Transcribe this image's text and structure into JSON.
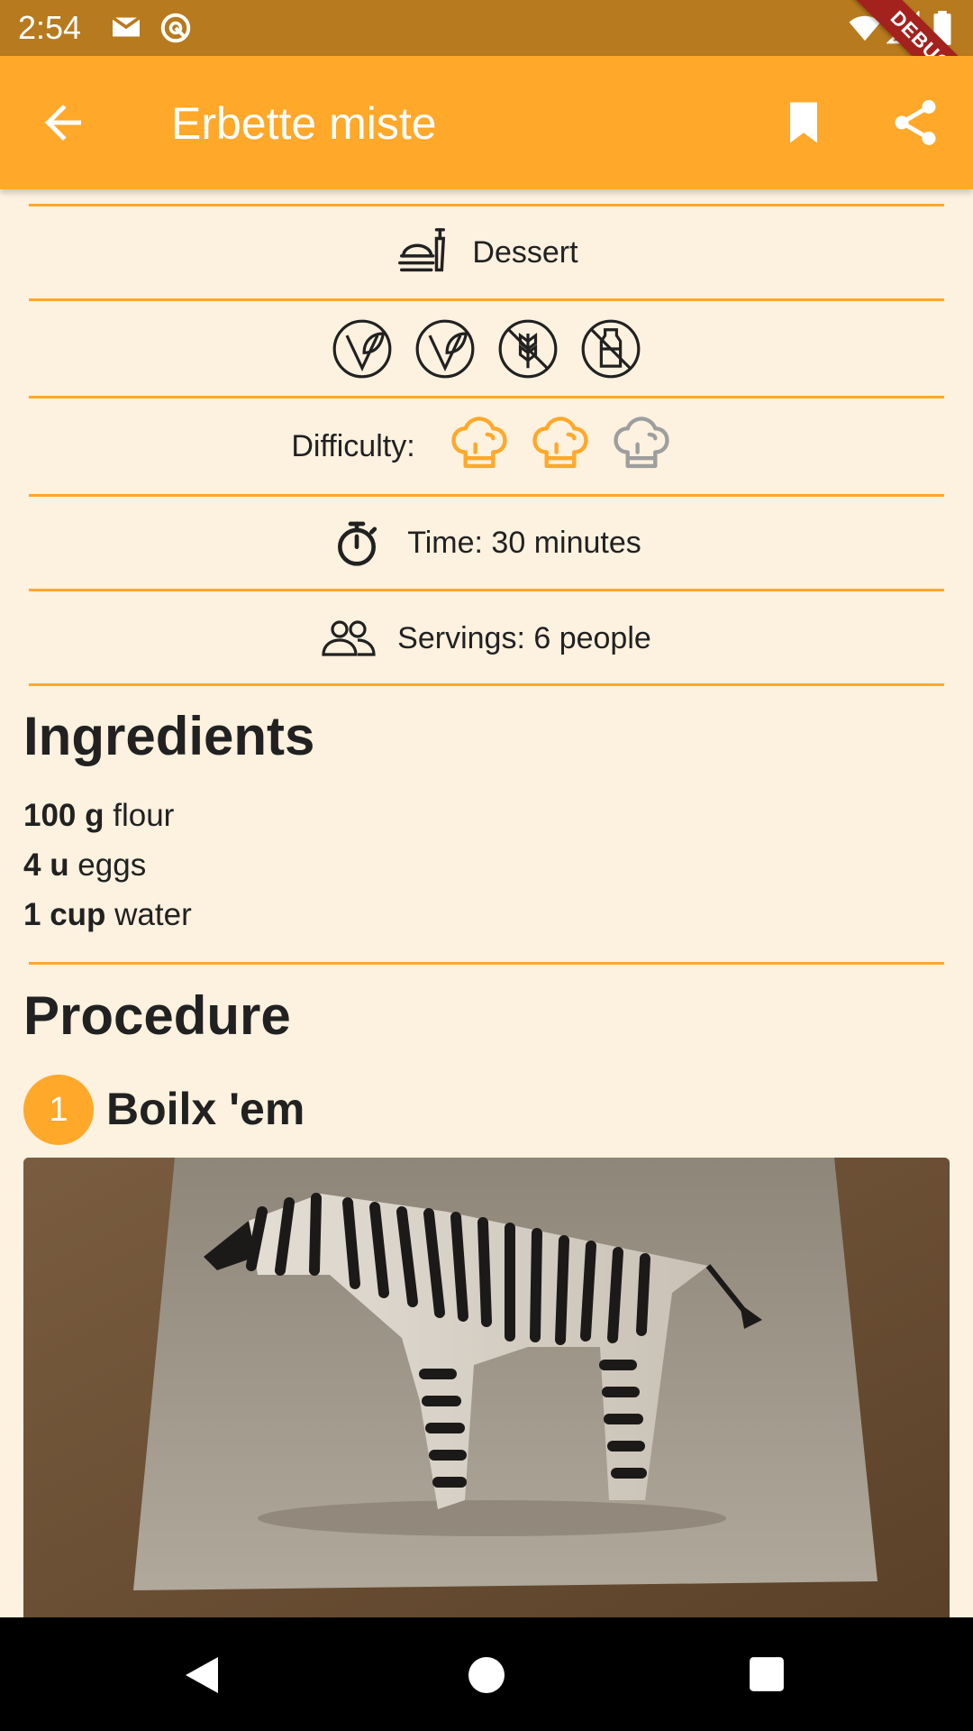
{
  "status_bar": {
    "time": "2:54",
    "icons": [
      "gmail-icon",
      "sync-icon",
      "wifi-icon",
      "signal-icon",
      "battery-icon"
    ],
    "debug_label": "DEBUG"
  },
  "app_bar": {
    "title": "Erbette miste",
    "back_icon": "arrow-back-icon",
    "bookmark_icon": "bookmark-icon",
    "share_icon": "share-icon",
    "color": "#ffa82a"
  },
  "info": {
    "category": "Dessert",
    "diet_icons": [
      "vegetarian-icon",
      "vegan-icon",
      "gluten-free-icon",
      "lactose-free-icon"
    ],
    "difficulty_label": "Difficulty:",
    "difficulty_level": 2,
    "difficulty_max": 3,
    "time_text": "Time: 30 minutes",
    "servings_text": "Servings: 6 people"
  },
  "ingredients": {
    "title": "Ingredients",
    "items": [
      {
        "qty": "100 g",
        "name": "flour"
      },
      {
        "qty": "4 u",
        "name": "eggs"
      },
      {
        "qty": "1 cup",
        "name": "water"
      }
    ]
  },
  "procedure": {
    "title": "Procedure",
    "steps": [
      {
        "number": "1",
        "title": "Boilx 'em"
      }
    ]
  },
  "nav_bar": {
    "icons": [
      "back-triangle-icon",
      "home-circle-icon",
      "recents-square-icon"
    ]
  }
}
